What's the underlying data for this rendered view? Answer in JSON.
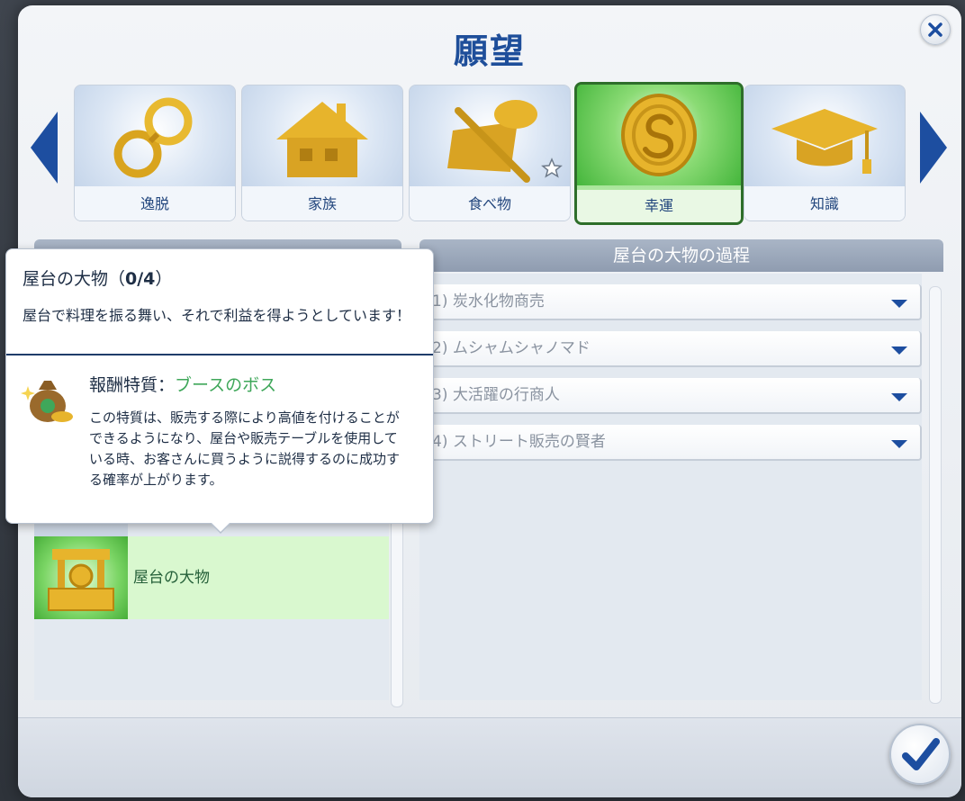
{
  "dialog": {
    "title": "願望"
  },
  "categories": [
    {
      "label": "逸脱",
      "icon": "handcuffs-icon",
      "selected": false
    },
    {
      "label": "家族",
      "icon": "house-icon",
      "selected": false
    },
    {
      "label": "食べ物",
      "icon": "food-icon",
      "selected": false
    },
    {
      "label": "幸運",
      "icon": "coin-icon",
      "selected": true
    },
    {
      "label": "知識",
      "icon": "graduation-cap-icon",
      "selected": false
    }
  ],
  "right_panel": {
    "header": "屋台の大物の過程",
    "steps": [
      {
        "label": "1) 炭水化物商売"
      },
      {
        "label": "2) ムシャムシャノマド"
      },
      {
        "label": "3) 大活躍の行商人"
      },
      {
        "label": "4) ストリート販売の賢者"
      }
    ]
  },
  "left_panel": {
    "aspiration_item": "屋台の大物"
  },
  "tooltip": {
    "title": "屋台の大物（",
    "progress": "0/4",
    "title_suffix": "）",
    "description": "屋台で料理を振る舞い、それで利益を得ようとしています！",
    "reward_label": "報酬特質：",
    "reward_name": "ブースのボス",
    "reward_description": "この特質は、販売する際により高値を付けることができるようになり、屋台や販売テーブルを使用している時、お客さんに買うように説得するのに成功する確率が上がります。"
  },
  "colors": {
    "accent_blue": "#1d4ea0",
    "selected_green": "#45b63c",
    "reward_green": "#3fa75a"
  }
}
